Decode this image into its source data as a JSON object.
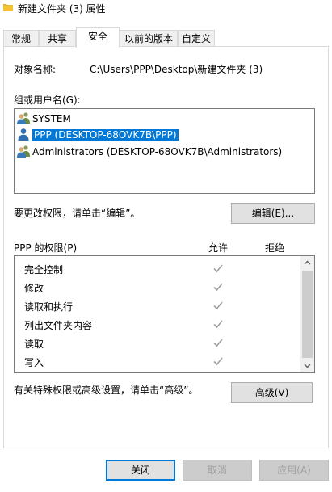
{
  "window": {
    "title": "新建文件夹 (3) 属性"
  },
  "tabs": [
    {
      "label": "常规"
    },
    {
      "label": "共享"
    },
    {
      "label": "安全"
    },
    {
      "label": "以前的版本"
    },
    {
      "label": "自定义"
    }
  ],
  "active_tab": "安全",
  "object": {
    "label": "对象名称:",
    "value": "C:\\Users\\PPP\\Desktop\\新建文件夹 (3)"
  },
  "groups": {
    "label": "组或用户名(G):",
    "items": [
      {
        "name": "SYSTEM",
        "icon": "group-user-icon"
      },
      {
        "name": "PPP (DESKTOP-68OVK7B\\PPP)",
        "icon": "single-user-icon",
        "selected": true
      },
      {
        "name": "Administrators (DESKTOP-68OVK7B\\Administrators)",
        "icon": "group-user-icon"
      }
    ]
  },
  "edit": {
    "hint": "要更改权限，请单击“编辑”。",
    "button": "编辑(E)..."
  },
  "permissions": {
    "label": "PPP 的权限(P)",
    "allow_header": "允许",
    "deny_header": "拒绝",
    "rows": [
      {
        "name": "完全控制",
        "allow": true,
        "deny": false
      },
      {
        "name": "修改",
        "allow": true,
        "deny": false
      },
      {
        "name": "读取和执行",
        "allow": true,
        "deny": false
      },
      {
        "name": "列出文件夹内容",
        "allow": true,
        "deny": false
      },
      {
        "name": "读取",
        "allow": true,
        "deny": false
      },
      {
        "name": "写入",
        "allow": true,
        "deny": false
      }
    ]
  },
  "advanced": {
    "hint": "有关特殊权限或高级设置，请单击“高级”。",
    "button": "高级(V)"
  },
  "footer": {
    "ok": "关闭",
    "cancel": "取消",
    "apply": "应用(A)"
  },
  "colors": {
    "selection": "#0078d7",
    "check": "#a0a0a0",
    "folder": "#f4c430"
  }
}
